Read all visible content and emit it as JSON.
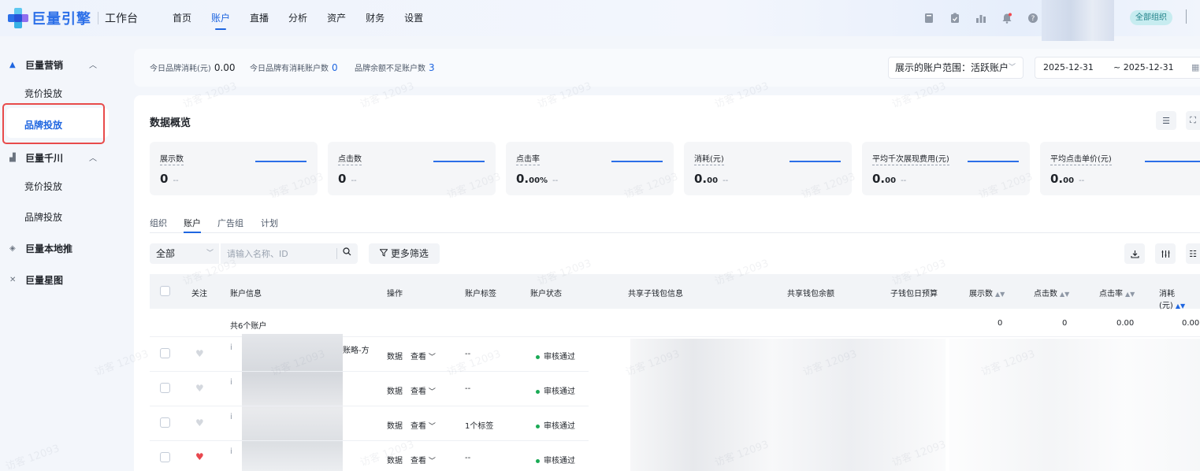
{
  "header": {
    "brand": "巨量引擎",
    "workspace": "工作台",
    "nav": [
      {
        "label": "首页"
      },
      {
        "label": "账户",
        "active": true
      },
      {
        "label": "直播"
      },
      {
        "label": "分析"
      },
      {
        "label": "资产"
      },
      {
        "label": "财务"
      },
      {
        "label": "设置"
      }
    ],
    "tool_icons": [
      "book-icon",
      "clipboard-icon",
      "chart-icon",
      "bell-icon",
      "help-icon"
    ],
    "org_label": "全部组织"
  },
  "sidebar": {
    "groups": [
      {
        "label": "巨量营销",
        "icon": "triangle-logo-icon",
        "expanded": true,
        "items": [
          "竞价投放",
          "品牌投放"
        ]
      },
      {
        "label": "巨量千川",
        "icon": "qianchuan-logo-icon",
        "expanded": true,
        "items": [
          "竞价投放",
          "品牌投放"
        ]
      },
      {
        "label": "巨量本地推",
        "icon": "bendi-logo-icon"
      },
      {
        "label": "巨量星图",
        "icon": "xingtu-logo-icon"
      }
    ],
    "active_item": "品牌投放"
  },
  "summary_bar": {
    "stats": [
      {
        "label": "今日品牌消耗(元)",
        "value": "0.00"
      },
      {
        "label": "今日品牌有消耗账户数",
        "value": "0"
      },
      {
        "label": "品牌余额不足账户数",
        "value": "3"
      }
    ],
    "range_label": "展示的账户范围：活跃账户",
    "date_start": "2025-12-31",
    "date_end": "~ 2025-12-31"
  },
  "overview": {
    "title": "数据概览",
    "metrics": [
      {
        "label": "展示数",
        "value": "0",
        "decimal": "",
        "compare": "--"
      },
      {
        "label": "点击数",
        "value": "0",
        "decimal": "",
        "compare": "--"
      },
      {
        "label": "点击率",
        "value": "0.",
        "decimal": "00%",
        "compare": "--"
      },
      {
        "label": "消耗(元)",
        "value": "0.",
        "decimal": "00",
        "compare": "--"
      },
      {
        "label": "平均千次展现费用(元)",
        "value": "0.",
        "decimal": "00",
        "compare": "--"
      },
      {
        "label": "平均点击单价(元)",
        "value": "0.",
        "decimal": "00",
        "compare": "--"
      }
    ]
  },
  "tabs": [
    "组织",
    "账户",
    "广告组",
    "计划"
  ],
  "active_tab": "账户",
  "toolbar": {
    "select_value": "全部",
    "search_placeholder": "请输入名称、ID",
    "more_filter_label": "更多筛选"
  },
  "table": {
    "headers": [
      "关注",
      "账户信息",
      "操作",
      "账户标签",
      "账户状态",
      "共享子钱包信息",
      "共享钱包余额",
      "子钱包日预算",
      "展示数",
      "点击数",
      "点击率",
      "消耗(元)"
    ],
    "total_label": "共6个账户",
    "totals": {
      "impressions": "0",
      "clicks": "0",
      "ctr": "0.00",
      "cost": "0.00"
    },
    "rows": [
      {
        "favorite": false,
        "info_prefix": "i",
        "info_suffix": "账略-方",
        "action_data": "数据",
        "action_view": "查看",
        "tag": "--",
        "status": "审核通过"
      },
      {
        "favorite": false,
        "info_prefix": "i",
        "info_suffix": "",
        "action_data": "数据",
        "action_view": "查看",
        "tag": "--",
        "status": "审核通过"
      },
      {
        "favorite": false,
        "info_prefix": "i",
        "info_suffix": "",
        "action_data": "数据",
        "action_view": "查看",
        "tag": "1个标签",
        "status": "审核通过"
      },
      {
        "favorite": true,
        "info_prefix": "i",
        "info_suffix": "",
        "action_data": "数据",
        "action_view": "查看",
        "tag": "--",
        "status": "审核通过"
      }
    ]
  },
  "watermark_text": "访客 12093",
  "colors": {
    "accent": "#1f66e0",
    "status_ok": "#1aaa55",
    "highlight": "#e84b4b",
    "heart_on": "#e8474e"
  }
}
